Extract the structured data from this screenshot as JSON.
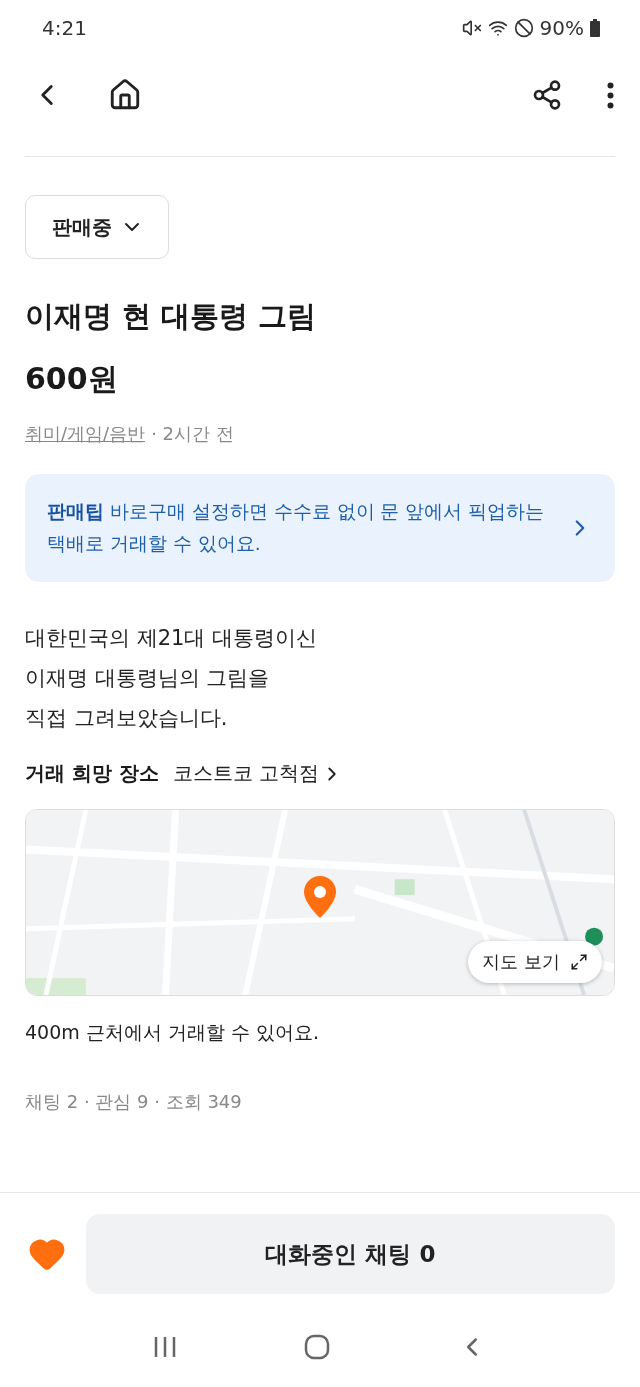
{
  "status_bar": {
    "time": "4:21",
    "battery": "90%"
  },
  "sale_status": {
    "label": "판매중"
  },
  "product": {
    "title": "이재명 현 대통령 그림",
    "price": "600원",
    "category": "취미/게임/음반",
    "posted": "· 2시간 전"
  },
  "tip": {
    "text": "**판매팁** 바로구매 설정하면 수수료 없이 문 앞에서 픽업하는 택배로 거래할 수 있어요."
  },
  "description": [
    "대한민국의 제21대 대통령이신",
    "이재명 대통령님의 그림을",
    "직접 그려보았습니다."
  ],
  "location": {
    "label": "거래 희망 장소",
    "place": "코스트코 고척점",
    "map_button": "지도 보기",
    "distance": "400m 근처에서 거래할 수 있어요."
  },
  "stats": "채팅 2 · 관심 9 · 조회 349",
  "bottom_bar": {
    "liked": true,
    "chat_button": "대화중인 채팅 0"
  }
}
